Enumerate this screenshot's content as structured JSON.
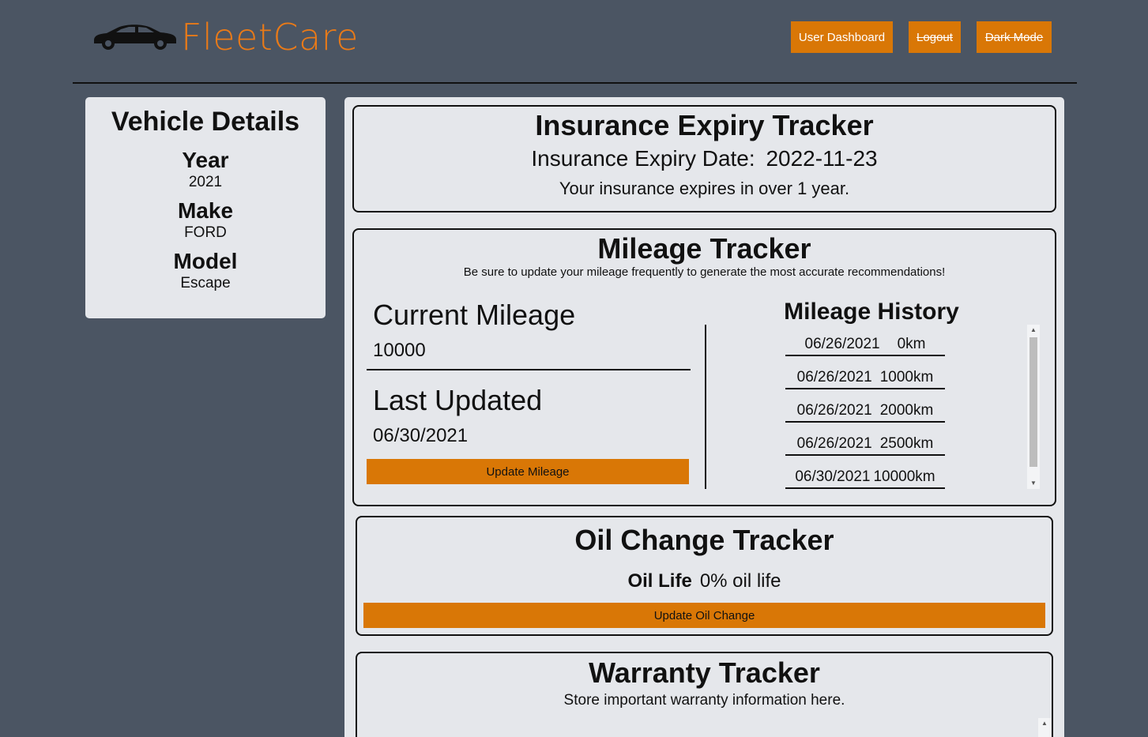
{
  "brand": {
    "name": "FleetCare",
    "accent_color": "#e97a18",
    "logo_icon": "car-icon"
  },
  "nav": {
    "dashboard": "User Dashboard",
    "logout": "Logout",
    "dark_mode": "Dark Mode"
  },
  "vehicle": {
    "title": "Vehicle Details",
    "year_label": "Year",
    "year": "2021",
    "make_label": "Make",
    "make": "FORD",
    "model_label": "Model",
    "model": "Escape"
  },
  "insurance": {
    "title": "Insurance Expiry Tracker",
    "date_label": "Insurance Expiry Date:",
    "date": "2022-11-23",
    "note": "Your insurance expires in over 1 year."
  },
  "mileage": {
    "title": "Mileage Tracker",
    "subtitle": "Be sure to update your mileage frequently to generate the most accurate recommendations!",
    "current_label": "Current Mileage",
    "current_value": "10000",
    "updated_label": "Last Updated",
    "updated_value": "06/30/2021",
    "update_button": "Update Mileage",
    "history_title": "Mileage History",
    "history": [
      {
        "date": "06/26/2021",
        "value": "0km"
      },
      {
        "date": "06/26/2021",
        "value": "1000km"
      },
      {
        "date": "06/26/2021",
        "value": "2000km"
      },
      {
        "date": "06/26/2021",
        "value": "2500km"
      },
      {
        "date": "06/30/2021",
        "value": "10000km"
      }
    ]
  },
  "oil": {
    "title": "Oil Change Tracker",
    "life_label": "Oil Life",
    "life_value": "0% oil life",
    "update_button": "Update Oil Change"
  },
  "warranty": {
    "title": "Warranty Tracker",
    "subtitle": "Store important warranty information here."
  }
}
